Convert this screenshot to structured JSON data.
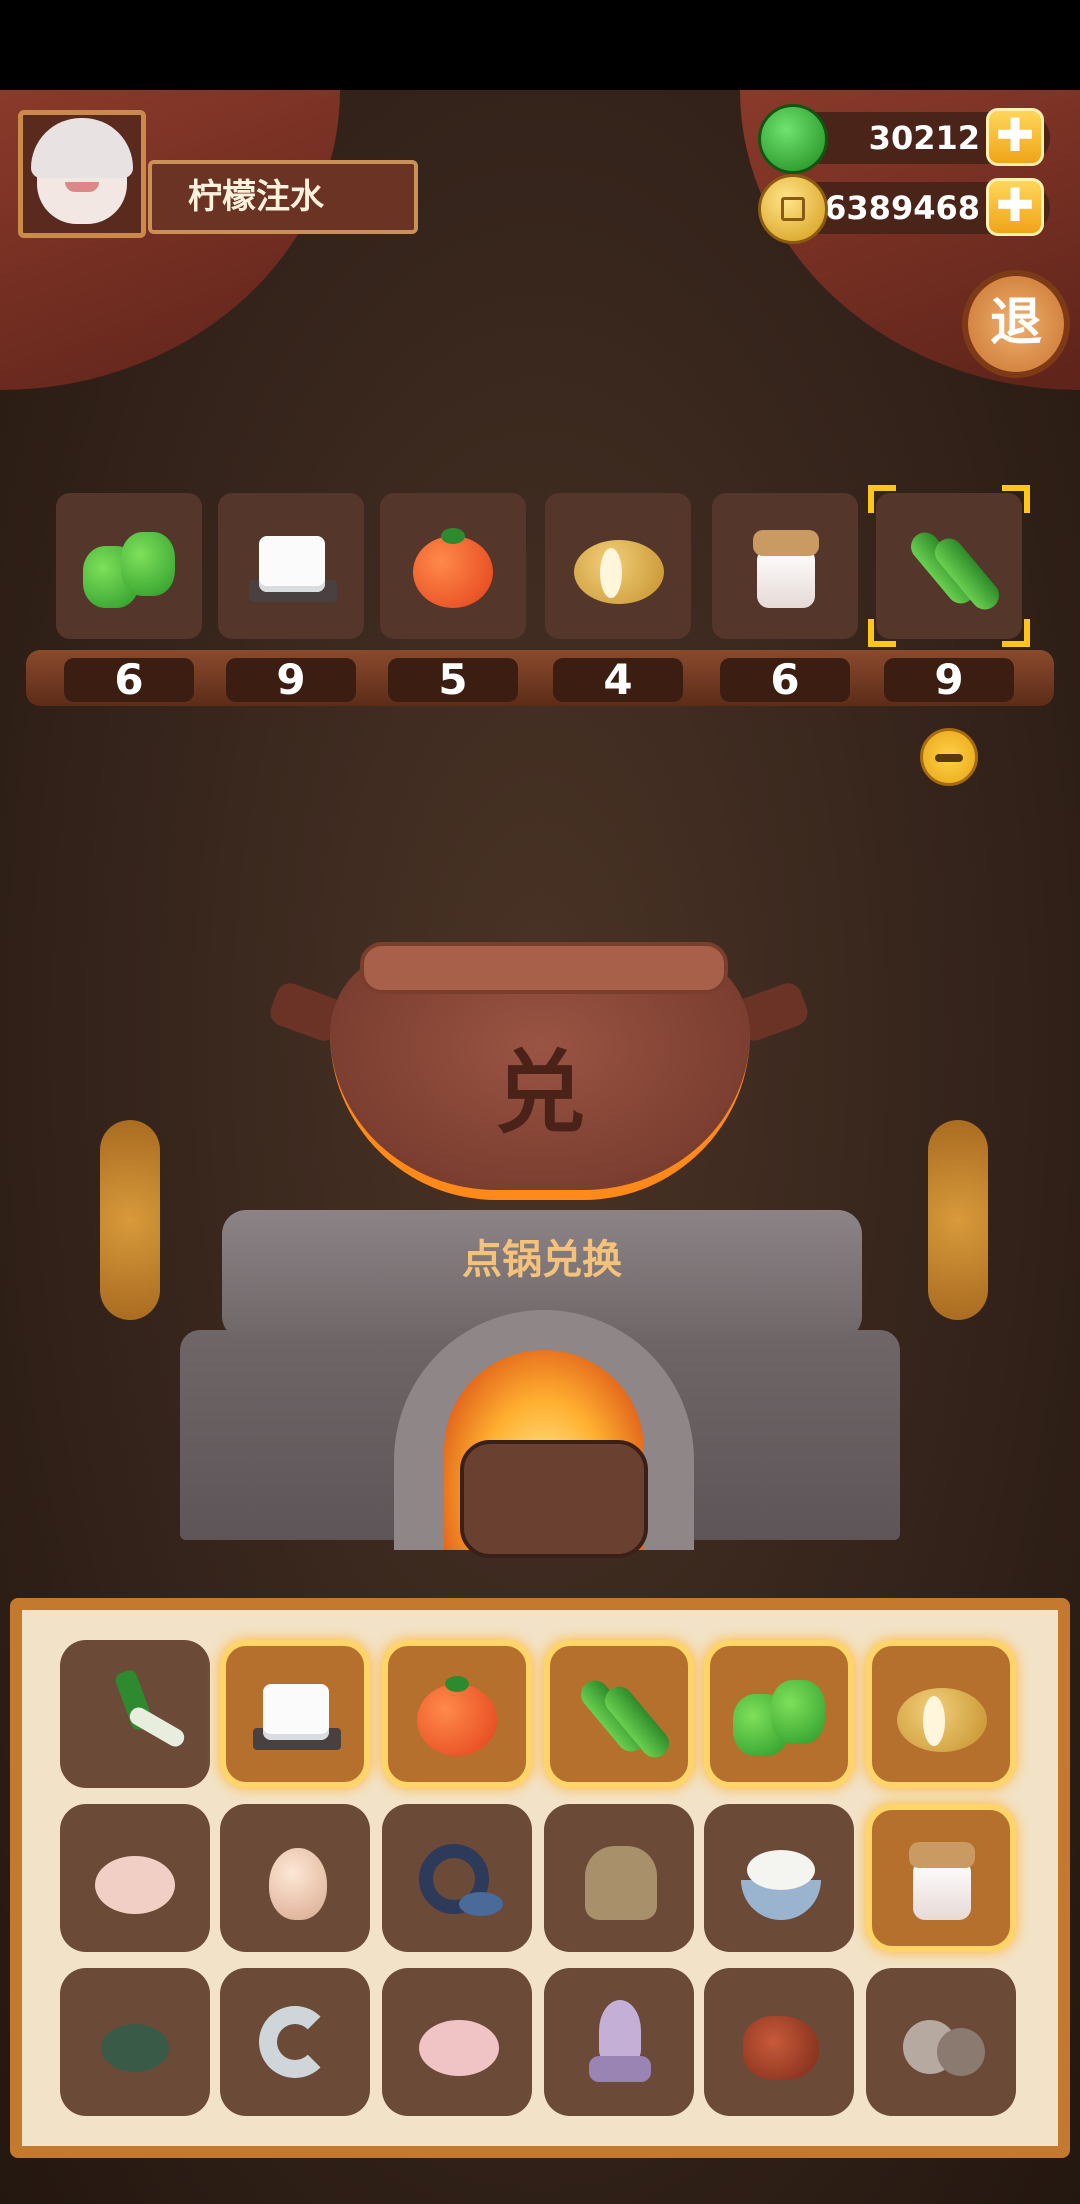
{
  "player": {
    "name": "柠檬注水"
  },
  "currency": {
    "gems": "30212",
    "coins": "16389468",
    "plus_label": "✚"
  },
  "exit_button": {
    "label": "退"
  },
  "shelf": {
    "slots": [
      {
        "item": "green-pepper",
        "count": "6"
      },
      {
        "item": "tofu",
        "count": "9"
      },
      {
        "item": "tomato",
        "count": "5"
      },
      {
        "item": "potato",
        "count": "4"
      },
      {
        "item": "jar",
        "count": "6"
      },
      {
        "item": "cucumber",
        "count": "9",
        "selected": true
      }
    ]
  },
  "pot": {
    "glyph": "兑"
  },
  "stove": {
    "label": "点锅兑换"
  },
  "inventory": {
    "rows": [
      [
        "leek",
        "tofu",
        "tomato",
        "cucumber",
        "green-pepper",
        "potato"
      ],
      [
        "chicken",
        "egg",
        "fish",
        "sack",
        "rice",
        "jar"
      ],
      [
        "crab",
        "shrimp",
        "duck",
        "squid",
        "meat",
        "clam"
      ]
    ],
    "highlighted": [
      "tofu",
      "tomato",
      "cucumber",
      "green-pepper",
      "potato",
      "jar"
    ]
  }
}
